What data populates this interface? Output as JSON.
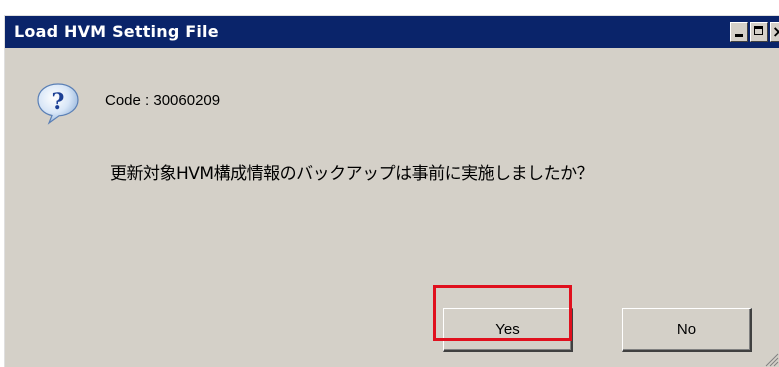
{
  "window": {
    "title": "Load HVM Setting File",
    "controls": {
      "minimize_icon": "minimize-icon",
      "maximize_icon": "maximize-icon",
      "close_icon": "close-icon",
      "close_glyph": "×"
    }
  },
  "dialog": {
    "icon": "question-icon",
    "code_text": "Code : 30060209",
    "message": "更新対象HVM構成情報のバックアップは事前に実施しましたか？"
  },
  "buttons": {
    "yes_label": "Yes",
    "no_label": "No"
  },
  "colors": {
    "titlebar": "#0a246a",
    "dialog_bg": "#d4d0c8",
    "highlight": "#e0101e"
  }
}
